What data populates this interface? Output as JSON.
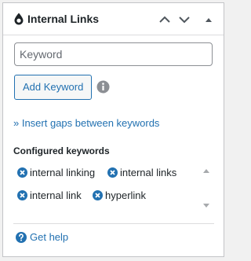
{
  "panel": {
    "title": "Internal Links",
    "icons": {
      "title": "drop-icon",
      "move_up": "chevron-up-icon",
      "move_down": "chevron-down-icon",
      "toggle": "caret-up-icon"
    }
  },
  "keyword_input": {
    "placeholder": "Keyword",
    "value": ""
  },
  "add_button": {
    "label": "Add Keyword"
  },
  "info_icon": "info-icon",
  "gaps_link": {
    "label": "» Insert gaps between keywords"
  },
  "configured": {
    "label": "Configured keywords",
    "keywords": [
      "internal linking",
      "internal links",
      "internal link",
      "hyperlink"
    ],
    "remove_icon": "remove-circle-icon"
  },
  "help": {
    "label": "Get help",
    "icon": "question-circle-icon"
  },
  "colors": {
    "accent": "#2271b1",
    "text": "#1d2327",
    "border": "#c3c4c7",
    "muted": "#8c8f94"
  }
}
